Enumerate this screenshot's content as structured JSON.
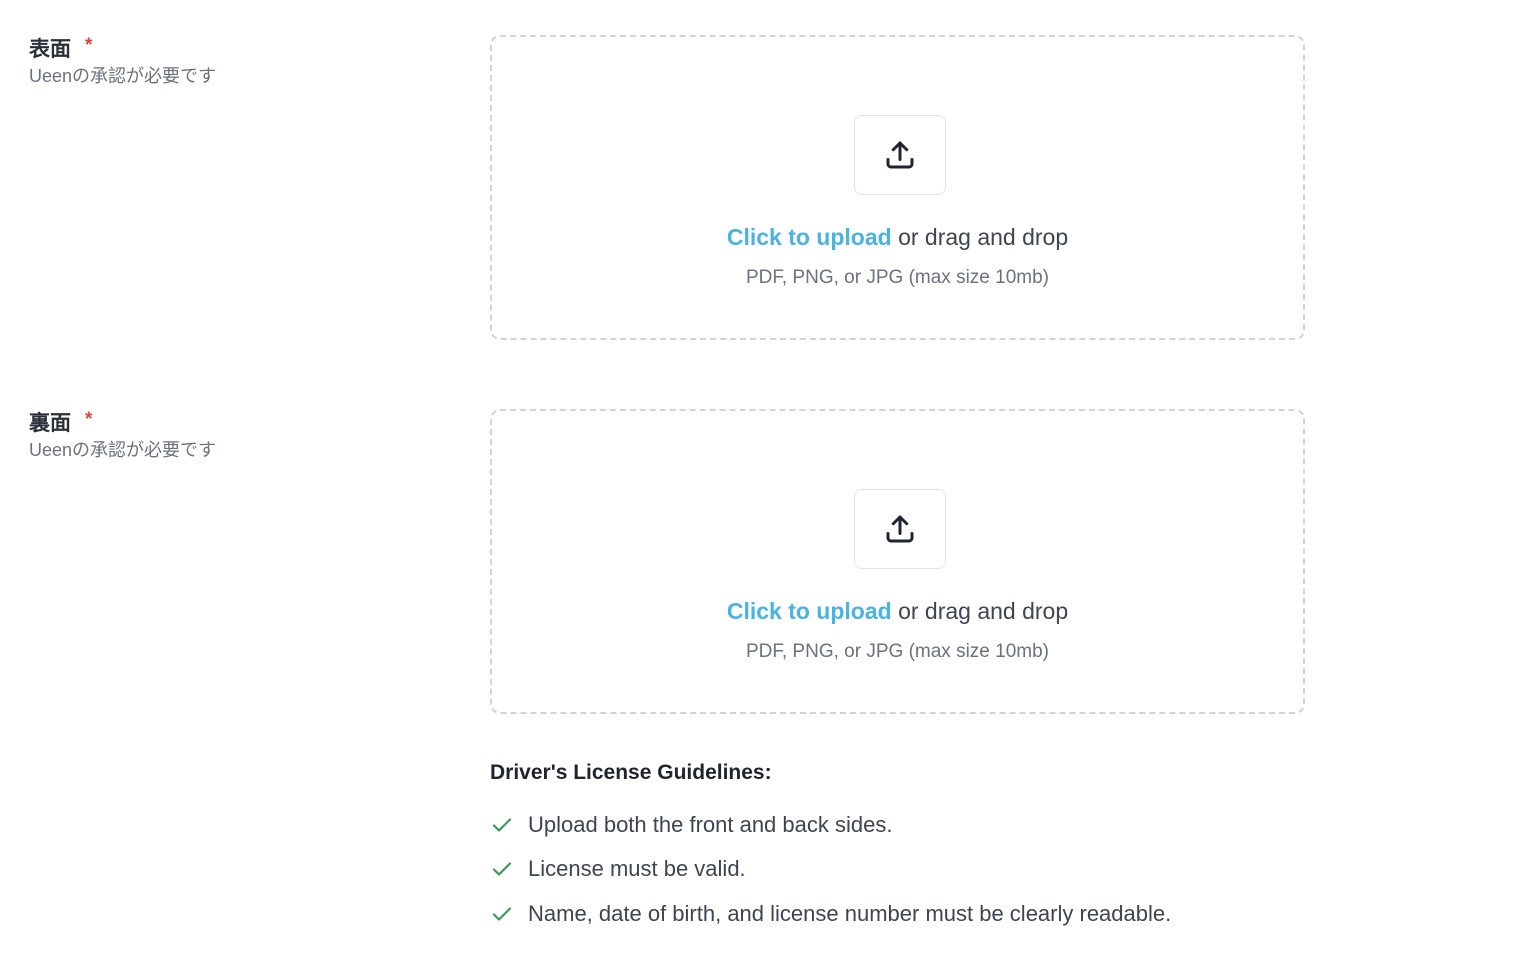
{
  "fields": [
    {
      "title": "表面",
      "required_mark": "*",
      "hint": "Ueenの承認が必要です",
      "upload": {
        "icon": "upload-icon",
        "link_text": "Click to upload",
        "rest_text": " or drag and drop",
        "formats": "PDF, PNG, or JPG (max size 10mb)"
      }
    },
    {
      "title": "裏面",
      "required_mark": "*",
      "hint": "Ueenの承認が必要です",
      "upload": {
        "icon": "upload-icon",
        "link_text": "Click to upload",
        "rest_text": " or drag and drop",
        "formats": "PDF, PNG, or JPG (max size 10mb)"
      }
    }
  ],
  "guidelines": {
    "title": "Driver's License Guidelines:",
    "check_icon": "check-icon",
    "check_color": "#3a9b53",
    "items": [
      "Upload both the front and back sides.",
      "License must be valid.",
      "Name, date of birth, and license number must be clearly readable."
    ]
  },
  "colors": {
    "accent": "#4ab3df",
    "required": "#d9453d",
    "dropzone_border": "#d2d3d6"
  }
}
